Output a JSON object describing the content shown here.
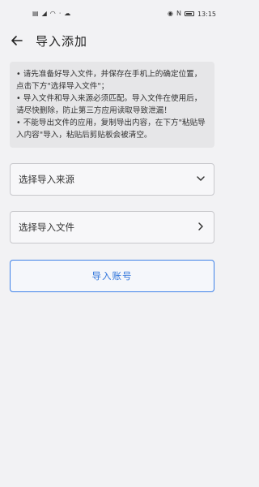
{
  "statusbar": {
    "left_icons": [
      "sim-hd-icon",
      "signal-icon",
      "wifi-icon",
      "speed-icon",
      "cloud-icon"
    ],
    "speed_text": "0\nK/s",
    "right_icons": [
      "eye-icon",
      "nfc-icon",
      "battery-icon"
    ],
    "time": "13:15"
  },
  "header": {
    "title": "导入添加"
  },
  "notice": {
    "lines": [
      "• 请先准备好导入文件，并保存在手机上的确定位置，点击下方\"选择导入文件\"；",
      "• 导入文件和导入来源必须匹配。导入文件在使用后，请尽快删除，防止第三方应用读取导致泄漏！",
      "• 不能导出文件的应用，复制导出内容，在下方\"粘贴导入内容\"导入，粘贴后剪贴板会被清空。"
    ]
  },
  "fields": {
    "source_label": "选择导入来源",
    "file_label": "选择导入文件"
  },
  "actions": {
    "import_label": "导入账号"
  },
  "colors": {
    "accent": "#3f82e8",
    "background": "#f2f2f4",
    "notice_bg": "#e6e6e8"
  }
}
